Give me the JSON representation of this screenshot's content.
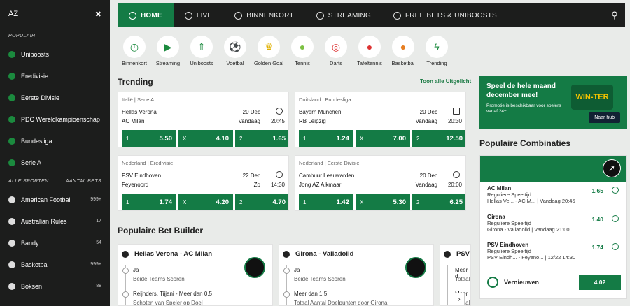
{
  "sidebar": {
    "az": "AZ",
    "populair_label": "POPULAIR",
    "items": [
      {
        "label": "Uniboosts"
      },
      {
        "label": "Eredivisie"
      },
      {
        "label": "Eerste Divisie"
      },
      {
        "label": "PDC Wereldkampioenschap"
      },
      {
        "label": "Bundesliga"
      },
      {
        "label": "Serie A"
      }
    ],
    "alle_label": "ALLE SPORTEN",
    "aantal_label": "AANTAL BETS",
    "sports": [
      {
        "label": "American Football",
        "count": "999+"
      },
      {
        "label": "Australian Rules",
        "count": "17"
      },
      {
        "label": "Bandy",
        "count": "54"
      },
      {
        "label": "Basketbal",
        "count": "999+"
      },
      {
        "label": "Boksen",
        "count": "88"
      }
    ]
  },
  "nav": {
    "tabs": [
      {
        "label": "HOME"
      },
      {
        "label": "LIVE"
      },
      {
        "label": "BINNENKORT"
      },
      {
        "label": "STREAMING"
      },
      {
        "label": "FREE BETS & UNIBOOSTS"
      }
    ]
  },
  "sports_row": [
    {
      "label": "Binnenkort",
      "icon": "clock-icon"
    },
    {
      "label": "Streaming",
      "icon": "play-icon"
    },
    {
      "label": "Uniboosts",
      "icon": "boost-icon"
    },
    {
      "label": "Voetbal",
      "icon": "football-icon"
    },
    {
      "label": "Golden Goal",
      "icon": "trophy-icon"
    },
    {
      "label": "Tennis",
      "icon": "tennis-icon"
    },
    {
      "label": "Darts",
      "icon": "darts-icon"
    },
    {
      "label": "Tafeltennis",
      "icon": "pingpong-icon"
    },
    {
      "label": "Basketbal",
      "icon": "basketball-icon"
    },
    {
      "label": "Trending",
      "icon": "bolt-icon"
    }
  ],
  "trending": {
    "title": "Trending",
    "see_all": "Toon alle Uitgelicht",
    "cards": [
      {
        "league": "Italië | Serie A",
        "team1": "Hellas Verona",
        "team2": "AC Milan",
        "date": "20 Dec",
        "day": "Vandaag",
        "time": "20:45",
        "odds": [
          {
            "k": "1",
            "v": "5.50"
          },
          {
            "k": "X",
            "v": "4.10"
          },
          {
            "k": "2",
            "v": "1.65"
          }
        ]
      },
      {
        "league": "Duitsland | Bundesliga",
        "team1": "Bayern München",
        "team2": "RB Leipzig",
        "date": "20 Dec",
        "day": "Vandaag",
        "time": "20:30",
        "odds": [
          {
            "k": "1",
            "v": "1.24"
          },
          {
            "k": "X",
            "v": "7.00"
          },
          {
            "k": "2",
            "v": "12.50"
          }
        ]
      },
      {
        "league": "Nederland | Eredivisie",
        "team1": "PSV Eindhoven",
        "team2": "Feyenoord",
        "date": "22 Dec",
        "day": "Zo",
        "time": "14:30",
        "odds": [
          {
            "k": "1",
            "v": "1.74"
          },
          {
            "k": "X",
            "v": "4.20"
          },
          {
            "k": "2",
            "v": "4.70"
          }
        ]
      },
      {
        "league": "Nederland | Eerste Divisie",
        "team1": "Cambuur Leeuwarden",
        "team2": "Jong AZ Alkmaar",
        "date": "20 Dec",
        "day": "Vandaag",
        "time": "20:00",
        "odds": [
          {
            "k": "1",
            "v": "1.42"
          },
          {
            "k": "X",
            "v": "5.30"
          },
          {
            "k": "2",
            "v": "6.25"
          }
        ]
      }
    ]
  },
  "promo": {
    "headline": "Speel de hele maand december mee!",
    "sub": "Promotie is beschikbaar voor spelers vanaf 24+",
    "button": "Naar hub",
    "art": "WIN-TER"
  },
  "combinaties": {
    "title": "Populaire Combinaties",
    "items": [
      {
        "name": "AC Milan",
        "market": "Reguliere Speeltijd",
        "info": "Hellas Ve... - AC M... | Vandaag 20:45",
        "odd": "1.65"
      },
      {
        "name": "Girona",
        "market": "Reguliere Speeltijd",
        "info": "Girona - Valladolid | Vandaag 21:00",
        "odd": "1.40"
      },
      {
        "name": "PSV Eindhoven",
        "market": "Reguliere Speeltijd",
        "info": "PSV Eindh... - Feyeno... | 12/22 14:30",
        "odd": "1.74"
      }
    ],
    "refresh_label": "Vernieuwen",
    "total": "4.02"
  },
  "bet_builder": {
    "title": "Populaire Bet Builder",
    "cards": [
      {
        "title": "Hellas Verona - AC Milan",
        "rows": [
          {
            "a": "Ja",
            "b": "Beide Teams Scoren"
          },
          {
            "a": "Reijnders, Tijjani - Meer dan 0.5",
            "b": "Schoten van Speler op Doel"
          }
        ]
      },
      {
        "title": "Girona - Valladolid",
        "rows": [
          {
            "a": "Ja",
            "b": "Beide Teams Scoren"
          },
          {
            "a": "Meer dan 1.5",
            "b": "Totaal Aantal Doelpunten door Girona"
          }
        ]
      },
      {
        "title": "PSV",
        "rows": [
          {
            "a": "Meer d",
            "b": "Totaal"
          },
          {
            "a": "Meer d",
            "b": "Totaal"
          }
        ]
      }
    ]
  }
}
